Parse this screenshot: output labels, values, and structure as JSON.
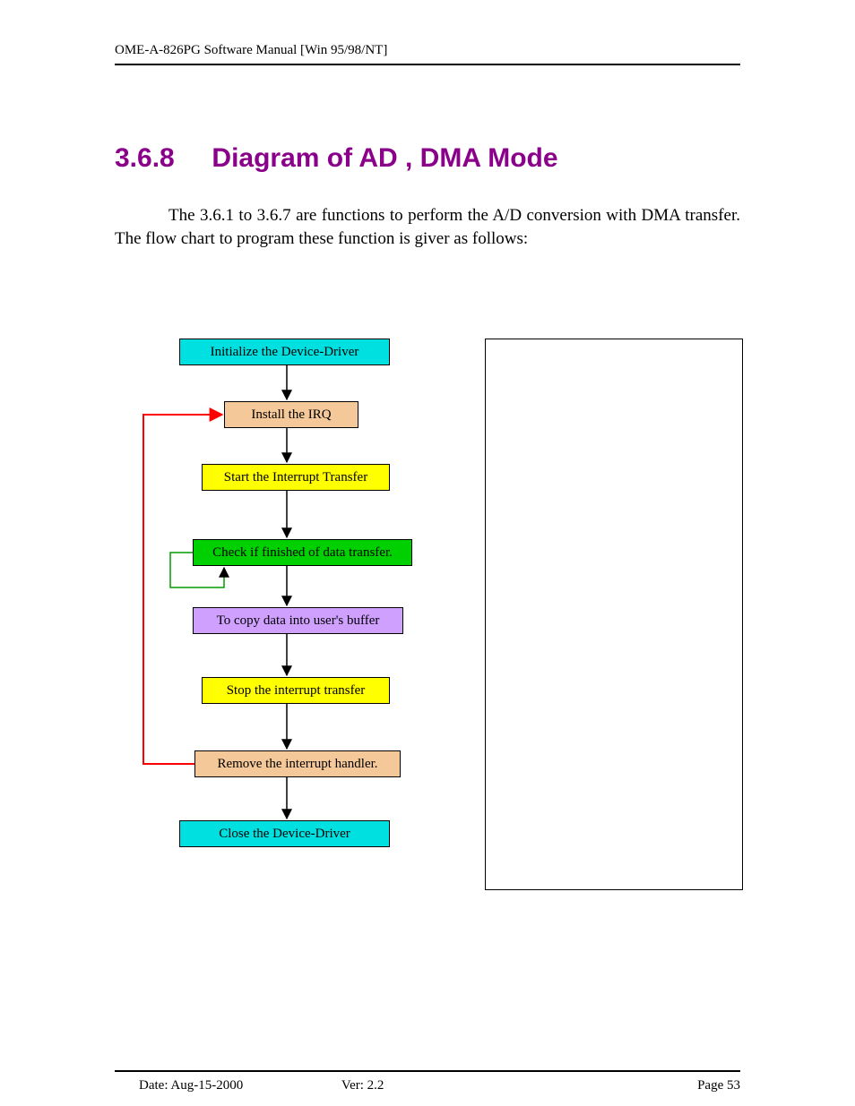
{
  "header": {
    "text": "OME-A-826PG Software Manual [Win 95/98/NT]"
  },
  "heading": {
    "number": "3.6.8",
    "title": "Diagram of AD , DMA Mode"
  },
  "paragraph": "The 3.6.1 to 3.6.7 are functions to perform the A/D conversion with DMA transfer. The flow chart to program these function is giver as follows:",
  "chart_data": {
    "type": "flowchart",
    "nodes": [
      {
        "id": "init",
        "label": "Initialize the Device-Driver",
        "fill": "#00e0e0"
      },
      {
        "id": "install",
        "label": "Install the IRQ",
        "fill": "#f5c89a"
      },
      {
        "id": "start",
        "label": "Start the Interrupt Transfer",
        "fill": "#ffff00"
      },
      {
        "id": "check",
        "label": "Check if finished of data transfer.",
        "fill": "#00d000"
      },
      {
        "id": "copy",
        "label": "To copy data into user's buffer",
        "fill": "#d0a0ff"
      },
      {
        "id": "stop",
        "label": "Stop the interrupt transfer",
        "fill": "#ffff00"
      },
      {
        "id": "remove",
        "label": "Remove the interrupt handler.",
        "fill": "#f5c89a"
      },
      {
        "id": "close",
        "label": "Close the Device-Driver",
        "fill": "#00e0e0"
      }
    ],
    "edges": [
      {
        "from": "init",
        "to": "install",
        "style": "down"
      },
      {
        "from": "install",
        "to": "start",
        "style": "down"
      },
      {
        "from": "start",
        "to": "check",
        "style": "down"
      },
      {
        "from": "check",
        "to": "copy",
        "style": "down"
      },
      {
        "from": "check",
        "to": "check",
        "style": "self-loop-left"
      },
      {
        "from": "copy",
        "to": "stop",
        "style": "down"
      },
      {
        "from": "stop",
        "to": "remove",
        "style": "down"
      },
      {
        "from": "remove",
        "to": "close",
        "style": "down"
      },
      {
        "from": "remove",
        "to": "install",
        "style": "loop-back-red"
      }
    ]
  },
  "footer": {
    "date": "Date: Aug-15-2000",
    "ver": "Ver: 2.2",
    "page": "Page  53"
  }
}
